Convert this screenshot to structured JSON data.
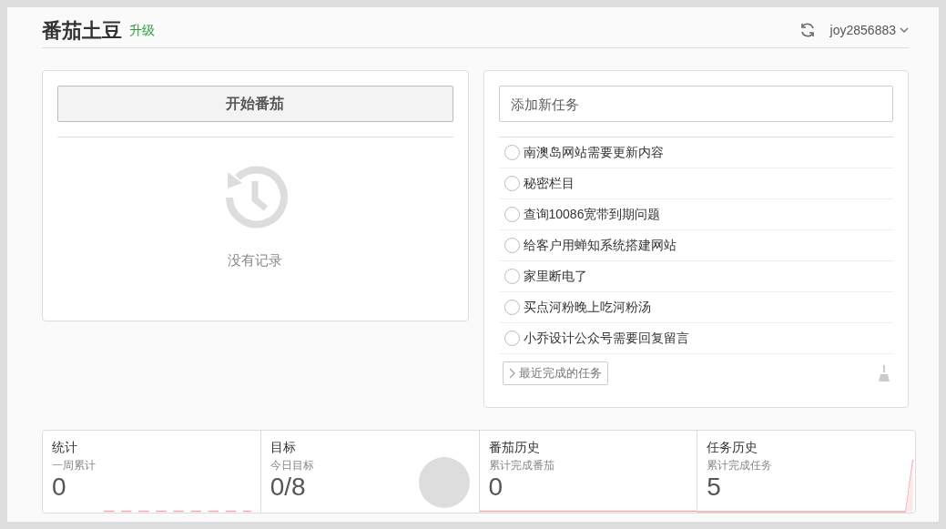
{
  "header": {
    "title": "番茄土豆",
    "upgrade": "升级",
    "user": "joy2856883"
  },
  "pomodoro": {
    "start_button": "开始番茄",
    "empty_text": "没有记录"
  },
  "tasks": {
    "placeholder": "添加新任务",
    "items": [
      {
        "text": "南澳岛网站需要更新内容",
        "checked": false
      },
      {
        "text": "秘密栏目",
        "checked": false
      },
      {
        "text": "查询10086宽带到期问题",
        "checked": false
      },
      {
        "text": "给客户用蝉知系统搭建网站",
        "checked": false
      },
      {
        "text": "家里断电了",
        "checked": false
      },
      {
        "text": "买点河粉晚上吃河粉汤",
        "checked": false
      },
      {
        "text": "小乔设计公众号需要回复留言",
        "checked": false
      }
    ],
    "recent_button": "最近完成的任务"
  },
  "stats": [
    {
      "kind": "dashed",
      "title": "统计",
      "subtitle": "一周累计",
      "value": "0"
    },
    {
      "kind": "circle",
      "title": "目标",
      "subtitle": "今日目标",
      "value": "0/8"
    },
    {
      "kind": "flat",
      "title": "番茄历史",
      "subtitle": "累计完成番茄",
      "value": "0"
    },
    {
      "kind": "rise",
      "title": "任务历史",
      "subtitle": "累计完成任务",
      "value": "5"
    }
  ]
}
